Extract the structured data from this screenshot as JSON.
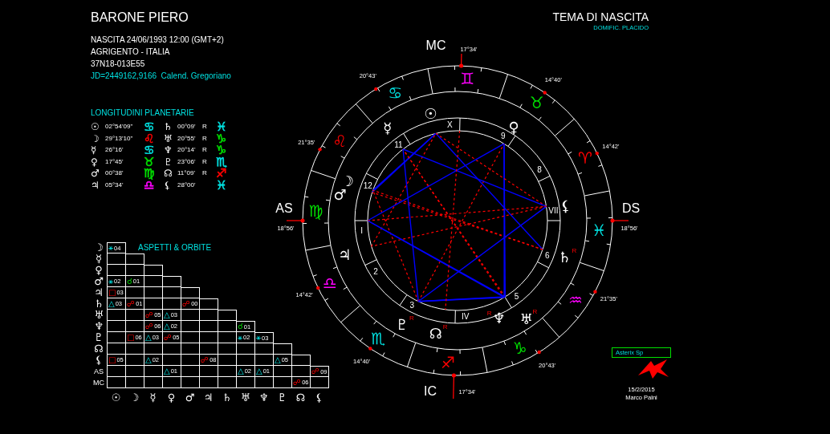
{
  "header": {
    "name": "BARONE PIERO",
    "details": [
      "NASCITA 24/06/1993 12:00 (GMT+2)",
      "AGRIGENTO - ITALIA",
      "37N18-013E55"
    ],
    "julian": "JD=2449162,9166  Calend. Gregoriano"
  },
  "chart_title": {
    "title": "TEMA DI NASCITA",
    "subtitle": "DOMIFIC. PLACIDO"
  },
  "longitudes": {
    "title": "LONGITUDINI PLANETARIE",
    "planets": [
      {
        "glyph": "☉",
        "position": "02°54'09\"",
        "sign": {
          "glyph": "♋",
          "color": "#00e0e0"
        }
      },
      {
        "glyph": "☽",
        "position": "29°13'10\"",
        "sign": {
          "glyph": "♌",
          "color": "#ff0000"
        }
      },
      {
        "glyph": "☿",
        "position": "26°16'",
        "sign": {
          "glyph": "♋",
          "color": "#00e0e0"
        }
      },
      {
        "glyph": "♀",
        "position": "17°45'",
        "sign": {
          "glyph": "♉",
          "color": "#00e000"
        }
      },
      {
        "glyph": "♂",
        "position": "00°38'",
        "sign": {
          "glyph": "♍",
          "color": "#00e000"
        }
      },
      {
        "glyph": "♃",
        "position": "05°34'",
        "sign": {
          "glyph": "♎",
          "color": "#ff00ff"
        }
      },
      {
        "glyph": "♄",
        "position": "00°09'",
        "motion": "R",
        "sign": {
          "glyph": "♓",
          "color": "#00e0e0"
        }
      },
      {
        "glyph": "♅",
        "position": "20°55'",
        "motion": "R",
        "sign": {
          "glyph": "♑",
          "color": "#00e000"
        }
      },
      {
        "glyph": "♆",
        "position": "20°14'",
        "motion": "R",
        "sign": {
          "glyph": "♑",
          "color": "#00e000"
        }
      },
      {
        "glyph": "♇",
        "position": "23°06'",
        "motion": "R",
        "sign": {
          "glyph": "♏",
          "color": "#00e0e0"
        }
      },
      {
        "glyph": "☊",
        "position": "11°09'",
        "motion": "R",
        "sign": {
          "glyph": "♐",
          "color": "#ff0000"
        }
      },
      {
        "glyph": "⚸",
        "position": "28°00'",
        "sign": {
          "glyph": "♓",
          "color": "#00e0e0"
        }
      }
    ]
  },
  "aspects": {
    "title": "ASPETTI & ORBITE",
    "rows": [
      {
        "label": "☽",
        "cells": [
          {
            "kind": "sextile",
            "symbol": "⚹",
            "orb": "04"
          }
        ]
      },
      {
        "label": "☿",
        "cells": [
          {},
          {}
        ]
      },
      {
        "label": "♀",
        "cells": [
          {},
          {},
          {}
        ]
      },
      {
        "label": "♂",
        "cells": [
          {
            "kind": "sextile",
            "symbol": "⚹",
            "orb": "02"
          },
          {
            "kind": "conjunction",
            "symbol": "☌",
            "orb": "01"
          },
          {},
          {}
        ]
      },
      {
        "label": "♃",
        "cells": [
          {
            "kind": "square",
            "symbol": "□",
            "orb": "03"
          },
          {},
          {},
          {},
          {}
        ]
      },
      {
        "label": "♄",
        "cells": [
          {
            "kind": "trine",
            "symbol": "△",
            "orb": "03"
          },
          {
            "kind": "opposition",
            "symbol": "☍",
            "orb": "01"
          },
          {},
          {},
          {
            "kind": "opposition",
            "symbol": "☍",
            "orb": "00"
          },
          {}
        ]
      },
      {
        "label": "♅",
        "cells": [
          {},
          {},
          {
            "kind": "opposition",
            "symbol": "☍",
            "orb": "05"
          },
          {
            "kind": "trine",
            "symbol": "△",
            "orb": "03"
          },
          {},
          {},
          {}
        ]
      },
      {
        "label": "♆",
        "cells": [
          {},
          {},
          {
            "kind": "opposition",
            "symbol": "☍",
            "orb": "06"
          },
          {
            "kind": "trine",
            "symbol": "△",
            "orb": "02"
          },
          {},
          {},
          {},
          {
            "kind": "conjunction",
            "symbol": "☌",
            "orb": "01"
          }
        ]
      },
      {
        "label": "♇",
        "cells": [
          {},
          {
            "kind": "square",
            "symbol": "□",
            "orb": "06"
          },
          {
            "kind": "trine",
            "symbol": "△",
            "orb": "03"
          },
          {
            "kind": "opposition",
            "symbol": "☍",
            "orb": "05"
          },
          {},
          {},
          {},
          {
            "kind": "sextile",
            "symbol": "⚹",
            "orb": "02"
          },
          {
            "kind": "sextile",
            "symbol": "⚹",
            "orb": "03"
          }
        ]
      },
      {
        "label": "☊",
        "cells": [
          {},
          {},
          {},
          {},
          {},
          {},
          {},
          {},
          {},
          {}
        ]
      },
      {
        "label": "⚸",
        "cells": [
          {
            "kind": "square",
            "symbol": "□",
            "orb": "05"
          },
          {},
          {
            "kind": "trine",
            "symbol": "△",
            "orb": "02"
          },
          {},
          {},
          {
            "kind": "opposition",
            "symbol": "☍",
            "orb": "08"
          },
          {},
          {},
          {},
          {
            "kind": "trine",
            "symbol": "△",
            "orb": "05"
          },
          {}
        ]
      },
      {
        "label": "AS",
        "cells": [
          {},
          {},
          {},
          {
            "kind": "trine",
            "symbol": "△",
            "orb": "01"
          },
          {},
          {},
          {},
          {
            "kind": "trine",
            "symbol": "△",
            "orb": "02"
          },
          {
            "kind": "trine",
            "symbol": "△",
            "orb": "01"
          },
          {},
          {},
          {
            "kind": "opposition",
            "symbol": "☍",
            "orb": "09"
          }
        ]
      },
      {
        "label": "MC",
        "cells": [
          {},
          {},
          {},
          {},
          {},
          {},
          {},
          {},
          {},
          {},
          {
            "kind": "opposition",
            "symbol": "☍",
            "orb": "06"
          },
          {}
        ]
      }
    ],
    "footer_glyphs": [
      "☉",
      "☽",
      "☿",
      "♀",
      "♂",
      "♃",
      "♄",
      "♅",
      "♆",
      "♇",
      "☊",
      "⚸"
    ]
  },
  "wheel": {
    "angles": [
      {
        "label": "AS",
        "degree": "18°56'"
      },
      {
        "label": "MC",
        "degree": "17°34'"
      },
      {
        "label": "DS",
        "degree": "18°56'"
      },
      {
        "label": "IC",
        "degree": "17°34'"
      }
    ],
    "signs": [
      {
        "glyph": "♈",
        "color": "#ff0000"
      },
      {
        "glyph": "♉",
        "color": "#00e000"
      },
      {
        "glyph": "♊",
        "color": "#ff00ff"
      },
      {
        "glyph": "♋",
        "color": "#00e0e0"
      },
      {
        "glyph": "♌",
        "color": "#ff0000"
      },
      {
        "glyph": "♍",
        "color": "#00e000"
      },
      {
        "glyph": "♎",
        "color": "#ff00ff"
      },
      {
        "glyph": "♏",
        "color": "#00e0e0"
      },
      {
        "glyph": "♐",
        "color": "#ff0000"
      },
      {
        "glyph": "♑",
        "color": "#00e000"
      },
      {
        "glyph": "♒",
        "color": "#ff00ff"
      },
      {
        "glyph": "♓",
        "color": "#00e0e0"
      }
    ],
    "houses": {
      "eastern": [
        {
          "number": "X"
        },
        {
          "number": "11",
          "cusp": "20°43'"
        },
        {
          "number": "12",
          "cusp": "21°35'"
        },
        {
          "number": "I"
        },
        {
          "number": "2",
          "cusp": "14°42'"
        },
        {
          "number": "3",
          "cusp": "14°40'"
        }
      ],
      "western": [
        {
          "number": "9",
          "cusp": "14°40'"
        },
        {
          "number": "8",
          "cusp": "14°42'"
        },
        {
          "number": "VII"
        },
        {
          "number": "6",
          "cusp": "21°35'"
        },
        {
          "number": "5",
          "cusp": "20°43'"
        },
        {
          "number": "IV"
        }
      ]
    },
    "planets": [
      {
        "glyph": "☉"
      },
      {
        "glyph": "☽"
      },
      {
        "glyph": "☿"
      },
      {
        "glyph": "♀"
      },
      {
        "glyph": "♂"
      },
      {
        "glyph": "♃"
      },
      {
        "glyph": "♄",
        "motion": "R"
      },
      {
        "glyph": "♆",
        "motion": "R"
      },
      {
        "glyph": "♅",
        "motion": "R"
      },
      {
        "glyph": "♇",
        "motion": "R"
      },
      {
        "glyph": "☊",
        "motion": "R"
      },
      {
        "glyph": "⚸"
      }
    ]
  },
  "signature": {
    "software": "Asterix Sp",
    "date": "15/2/2015",
    "author": "Marco Palni"
  }
}
